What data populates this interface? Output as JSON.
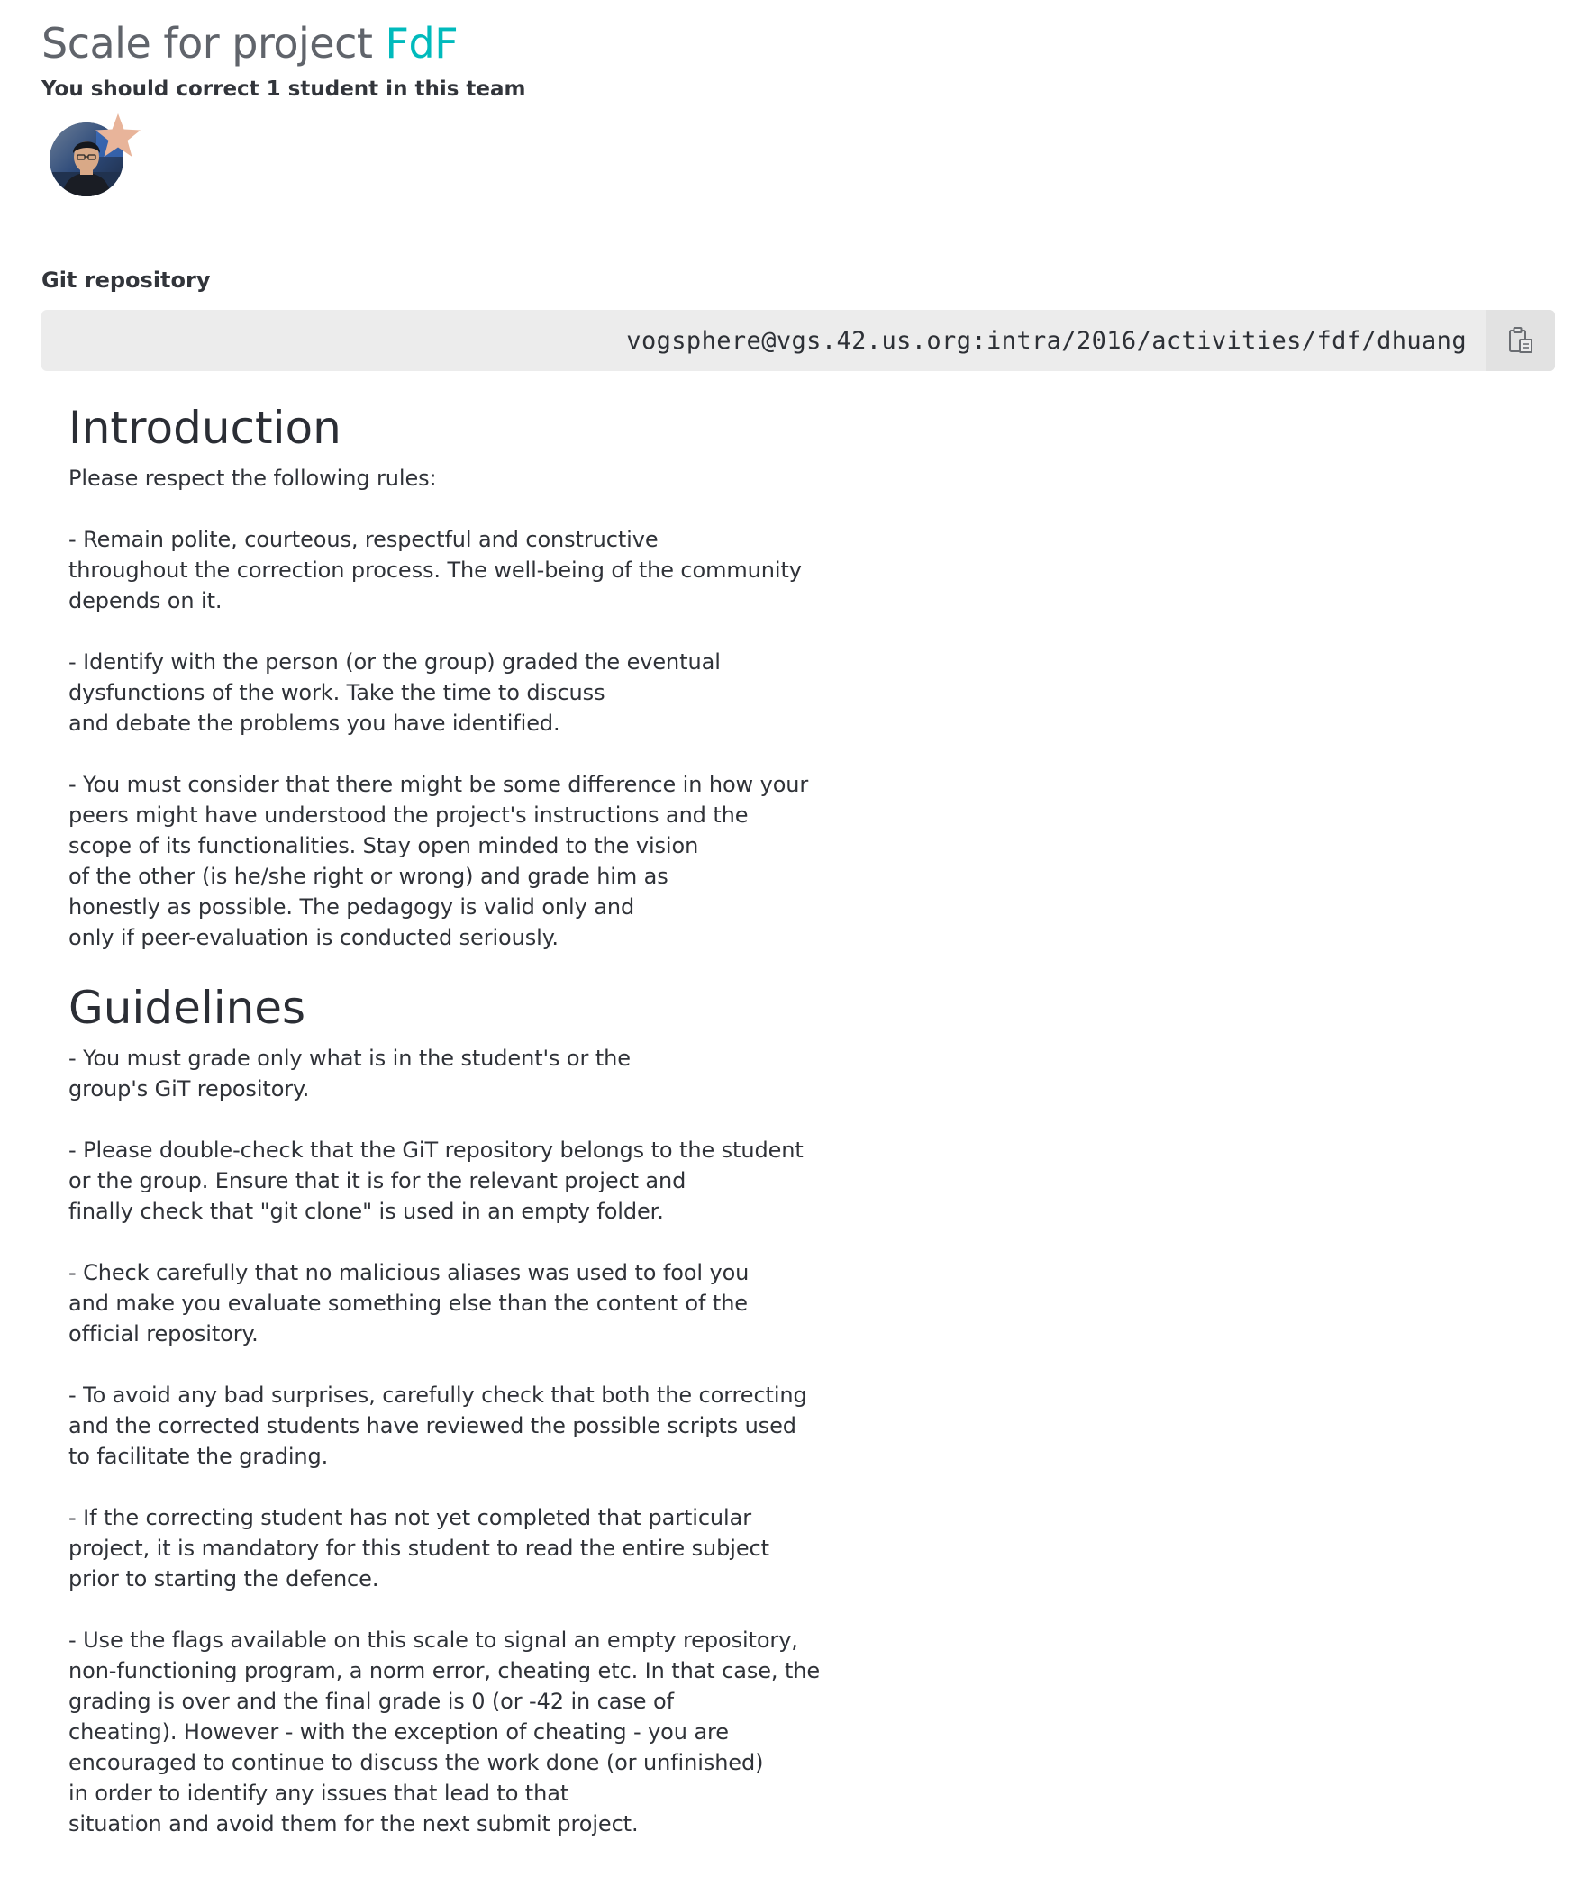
{
  "header": {
    "title_prefix": "Scale for project",
    "project_name": "FdF",
    "team_note": "You should correct 1 student in this team"
  },
  "team": {
    "members": [
      {
        "role": "leader",
        "avatar_icon": "user-avatar-photo"
      }
    ]
  },
  "repository": {
    "label": "Git repository",
    "url": "vogsphere@vgs.42.us.org:intra/2016/activities/fdf/dhuang",
    "copy_icon": "clipboard-icon"
  },
  "introduction": {
    "heading": "Introduction",
    "body": "Please respect the following rules:\n\n- Remain polite, courteous, respectful and constructive\nthroughout the correction process. The well-being of the community\ndepends on it.\n\n- Identify with the person (or the group) graded the eventual\ndysfunctions of the work. Take the time to discuss\nand debate the problems you have identified.\n\n- You must consider that there might be some difference in how your\npeers might have understood the project's instructions and the\nscope of its functionalities. Stay open minded to the vision\nof the other (is he/she right or wrong) and grade him as\nhonestly as possible. The pedagogy is valid only and\nonly if peer-evaluation is conducted seriously."
  },
  "guidelines": {
    "heading": "Guidelines",
    "body": "- You must grade only what is in the student's or the\ngroup's GiT repository.\n\n- Please double-check that the GiT repository belongs to the student\nor the group. Ensure that it is for the relevant project and\nfinally check that \"git clone\" is used in an empty folder.\n\n- Check carefully that no malicious aliases was used to fool you\nand make you evaluate something else than the content of the\nofficial repository.\n\n- To avoid any bad surprises, carefully check that both the correcting\nand the corrected students have reviewed the possible scripts used\nto facilitate the grading.\n\n- If the correcting student has not yet completed that particular\nproject, it is mandatory for this student to read the entire subject\nprior to starting the defence.\n\n- Use the flags available on this scale to signal an empty repository,\nnon-functioning program, a norm error, cheating etc. In that case, the\ngrading is over and the final grade is 0 (or -42 in case of\ncheating). However - with the exception of cheating - you are\nencouraged to continue to discuss the work done (or unfinished)\nin order to identify any issues that lead to that\nsituation and avoid them for the next submit project."
  },
  "colors": {
    "accent": "#00babc",
    "title_gray": "#60646b",
    "star": "#e8b49a",
    "git_box_bg": "#ececec"
  }
}
